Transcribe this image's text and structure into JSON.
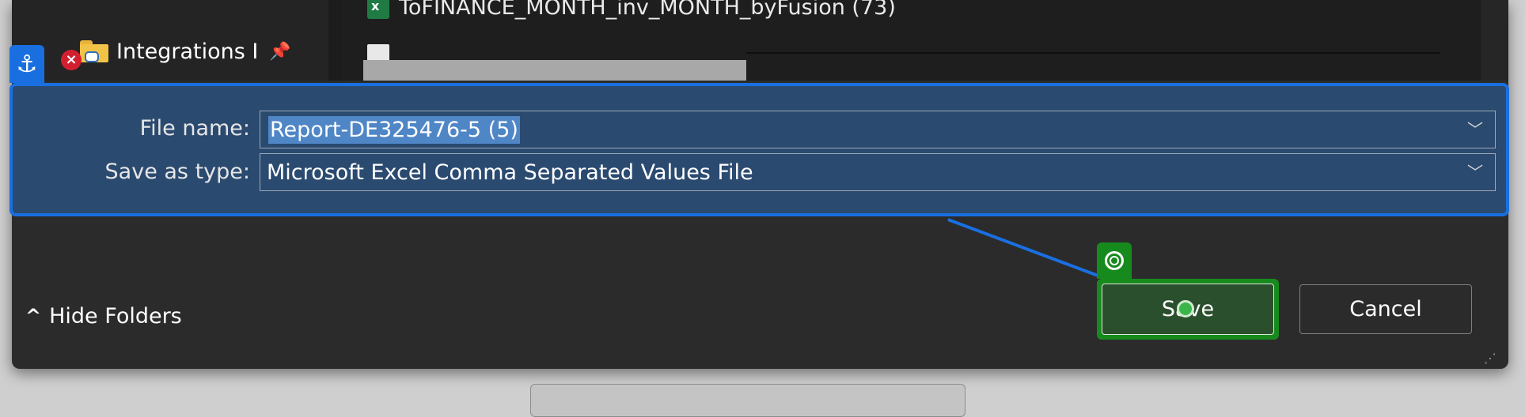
{
  "nav_pane": {
    "folder_label": "Integrations I",
    "folder_icon": "folder-network-icon",
    "pin_icon": "pin-icon",
    "error_badge": "×"
  },
  "file_list": {
    "row1_name": "ToFINANCE_MONTH_inv_MONTH_byFusion (73)",
    "row1_icon": "excel-file-icon",
    "row1_icon_glyph": "x",
    "row2_icon": "generic-file-icon"
  },
  "form": {
    "file_name_label": "File name:",
    "file_name_value": "Report-DE325476-5 (5)",
    "save_type_label": "Save as type:",
    "save_type_value": "Microsoft Excel Comma Separated Values File",
    "chevron_glyph": "﹀"
  },
  "annotations": {
    "anchor_glyph": "⚓",
    "highlight_color": "#1a6fe0",
    "target_color": "#178a1d"
  },
  "footer": {
    "hide_folders_label": "Hide Folders",
    "chevron_up": "^",
    "save_label": "Save",
    "cancel_label": "Cancel",
    "resize_glyph": "⋰"
  }
}
